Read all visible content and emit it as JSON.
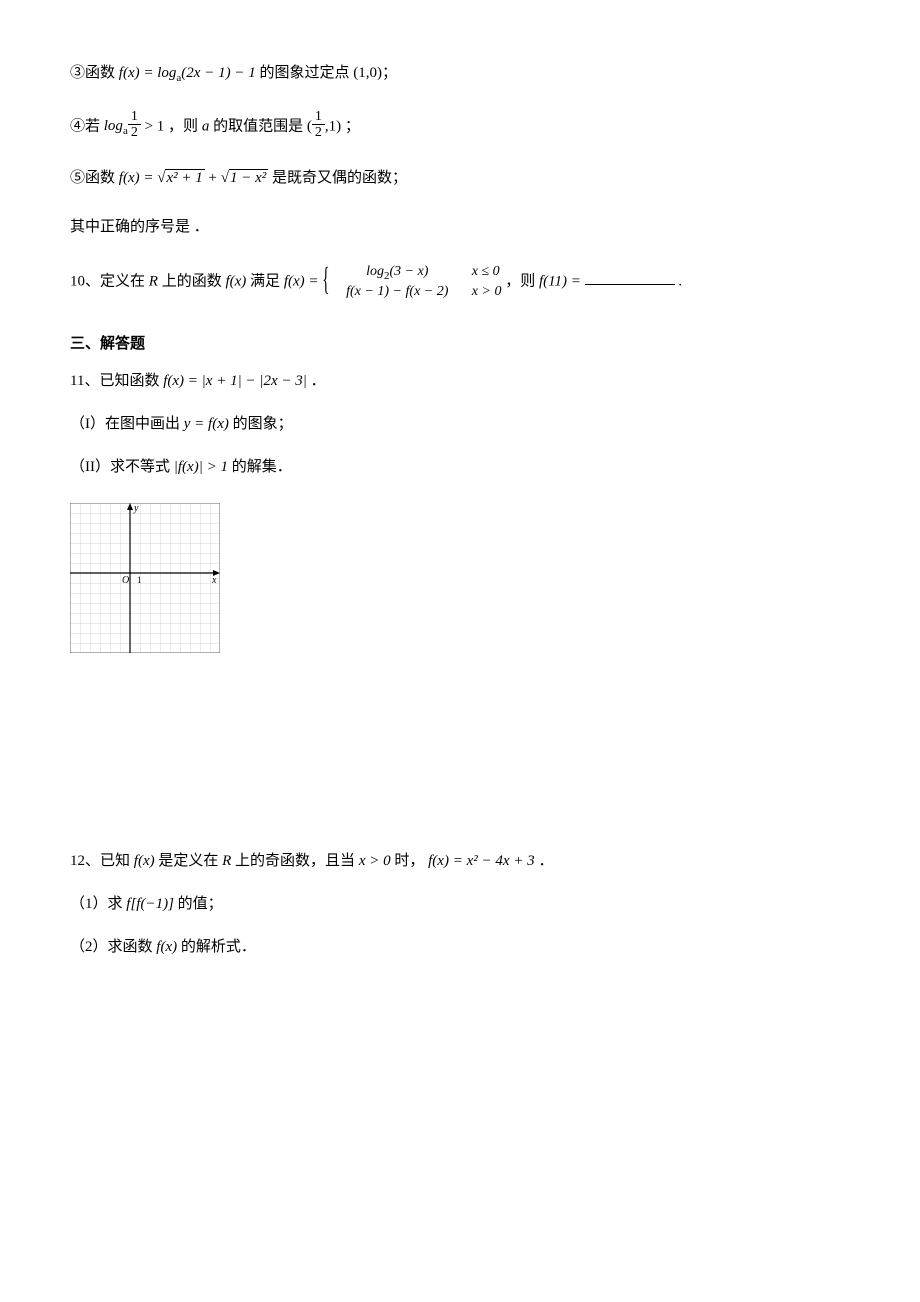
{
  "items": {
    "s3": {
      "prefix": "③函数 ",
      "formula": "f(x) = logₐ(2x − 1) − 1",
      "suffix": "的图象过定点 ",
      "point": "(1,0)",
      "tail": "；"
    },
    "s4": {
      "prefix": "④若 ",
      "log_base": "a",
      "frac_num": "1",
      "frac_den": "2",
      "gt": " > 1",
      "mid": "，则 ",
      "var": "a",
      "mid2": "的取值范围是 ",
      "rfrac_num": "1",
      "rfrac_den": "2",
      "rparen": ",1)",
      "tail": "；"
    },
    "s5": {
      "prefix": "⑤函数 ",
      "fx": "f(x) = ",
      "rad1": "x² + 1",
      "plus": " + ",
      "rad2": "1 − x²",
      "suffix": "是既奇又偶的函数；"
    },
    "conclusion": "其中正确的序号是  ．",
    "q10": {
      "prefix": "10、定义在 ",
      "R": "R",
      "mid": " 上的函数 ",
      "fx": "f(x)",
      "mid2": "满足 ",
      "fxeq": "f(x) = ",
      "row1a": "log₂(3 − x)",
      "row1b": "x ≤ 0",
      "row2a": "f(x − 1) − f(x − 2)",
      "row2b": "x > 0",
      "mid3": "，则 ",
      "f11": "f(11) = ",
      "tail": "."
    },
    "section3": "三、解答题",
    "q11": {
      "prefix": "11、已知函数 ",
      "formula": "f(x) = |x + 1| − |2x − 3|",
      "tail": "．",
      "p1a": "（I）在图中画出 ",
      "p1f": "y = f(x)",
      "p1b": "的图象；",
      "p2a": "（II）求不等式 ",
      "p2f": "|f(x)| > 1",
      "p2b": "的解集．"
    },
    "q12": {
      "prefix": "12、已知 ",
      "fx": "f(x)",
      "mid": " 是定义在 ",
      "R": "R",
      "mid2": " 上的奇函数，且当 ",
      "cond": "x > 0",
      "mid3": " 时，",
      "formula": "f(x) = x² − 4x + 3",
      "tail": "．",
      "p1a": "（1）求 ",
      "p1f": "f[f(−1)]",
      "p1b": " 的值；",
      "p2a": "（2）求函数 ",
      "p2f": "f(x)",
      "p2b": " 的解析式．"
    }
  }
}
